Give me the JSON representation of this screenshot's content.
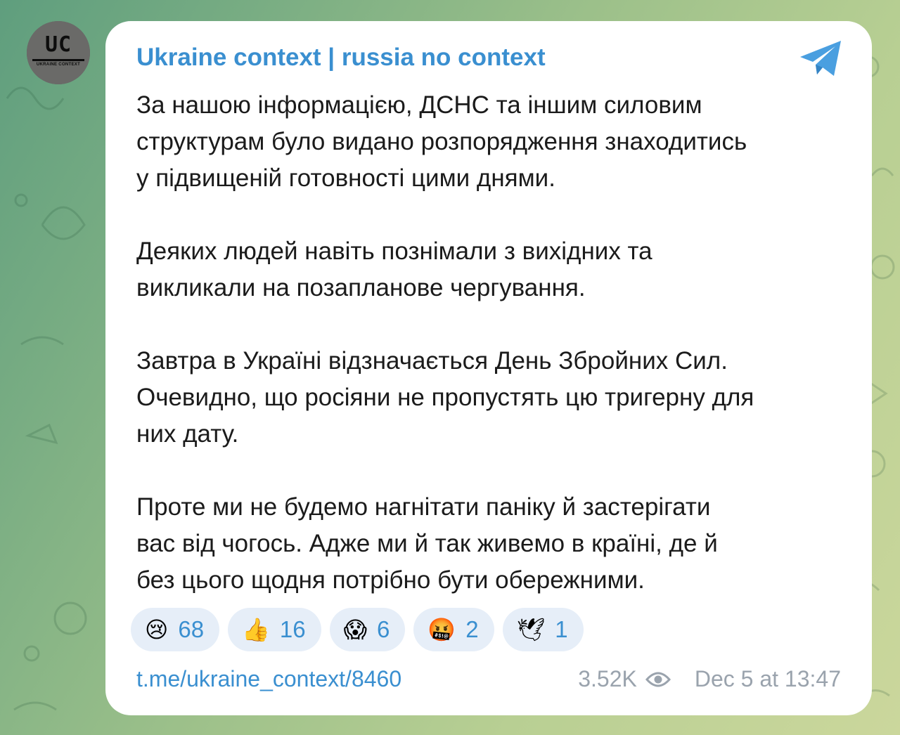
{
  "channel": {
    "name": "Ukraine context | russia no context",
    "avatar_mark": "UC",
    "avatar_subtext": "UKRAINE CONTEXT"
  },
  "message": {
    "paragraphs": [
      "За нашою інформацією, ДСНС та іншим силовим\nструктурам було видано розпорядження знаходитись\nу підвищеній готовності цими днями.",
      "Деяких людей навіть познімали з вихідних та\nвикликали на позапланове чергування.",
      "Завтра в Україні відзначається День Збройних Сил.\nОчевидно, що росіяни не пропустять цю тригерну для\nних дату.",
      "Проте ми не будемо нагнітати паніку й застерігати\nвас від чогось. Адже ми й так живемо в країні, де й\nбез цього щодня потрібно бути обережними."
    ]
  },
  "reactions": [
    {
      "emoji": "😢",
      "icon": "crying-face-icon",
      "count": "68"
    },
    {
      "emoji": "👍",
      "icon": "thumbs-up-icon",
      "count": "16"
    },
    {
      "emoji": "😱",
      "icon": "screaming-face-icon",
      "count": "6"
    },
    {
      "emoji": "🤬",
      "icon": "cursing-face-icon",
      "count": "2"
    },
    {
      "emoji": "🕊",
      "icon": "dove-icon",
      "count": "1"
    }
  ],
  "footer": {
    "link": "t.me/ukraine_context/8460",
    "views": "3.52K",
    "timestamp": "Dec 5 at 13:47"
  },
  "colors": {
    "accent": "#3a8fd0",
    "reaction_bg": "#e6eef8",
    "meta_text": "#9aa3ad"
  }
}
